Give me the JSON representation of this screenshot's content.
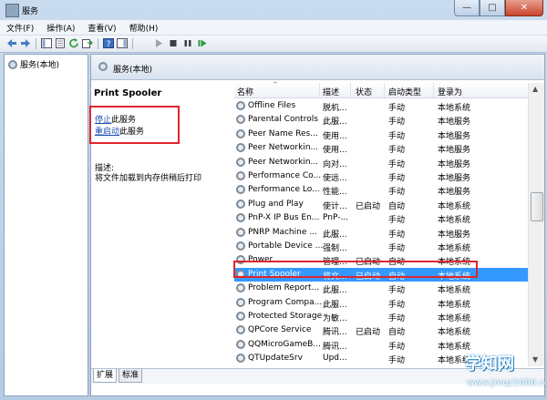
{
  "window": {
    "title": "服务",
    "controls": {
      "minimize": "—",
      "maximize": "□",
      "close": "✕"
    }
  },
  "menubar": [
    "文件(F)",
    "操作(A)",
    "查看(V)",
    "帮助(H)"
  ],
  "toolbar": {
    "icons": [
      "back-icon",
      "forward-icon",
      "console-tree-icon",
      "properties-icon",
      "refresh-icon",
      "export-icon",
      "help-icon",
      "action-pane-icon",
      "play-icon",
      "stop-icon",
      "pause-icon",
      "restart-icon"
    ]
  },
  "tree": {
    "item": "服务(本地)"
  },
  "pane_header": "服务(本地)",
  "detail": {
    "service_name": "Print Spooler",
    "stop_link": "停止",
    "stop_suffix": "此服务",
    "restart_link": "重启动",
    "restart_suffix": "此服务",
    "desc_label": "描述:",
    "desc": "将文件加载到内存供稍后打印"
  },
  "columns": [
    "名称",
    "描述",
    "状态",
    "启动类型",
    "登录为"
  ],
  "rows": [
    {
      "name": "Offline Files",
      "desc": "脱机...",
      "status": "",
      "startup": "手动",
      "logon": "本地系统"
    },
    {
      "name": "Parental Controls",
      "desc": "此服...",
      "status": "",
      "startup": "手动",
      "logon": "本地服务"
    },
    {
      "name": "Peer Name Res...",
      "desc": "使用...",
      "status": "",
      "startup": "手动",
      "logon": "本地服务"
    },
    {
      "name": "Peer Networkin...",
      "desc": "使用...",
      "status": "",
      "startup": "手动",
      "logon": "本地服务"
    },
    {
      "name": "Peer Networkin...",
      "desc": "向对...",
      "status": "",
      "startup": "手动",
      "logon": "本地服务"
    },
    {
      "name": "Performance Co...",
      "desc": "使远...",
      "status": "",
      "startup": "手动",
      "logon": "本地服务"
    },
    {
      "name": "Performance Lo...",
      "desc": "性能...",
      "status": "",
      "startup": "手动",
      "logon": "本地服务"
    },
    {
      "name": "Plug and Play",
      "desc": "使计...",
      "status": "已启动",
      "startup": "自动",
      "logon": "本地系统"
    },
    {
      "name": "PnP-X IP Bus En...",
      "desc": "PnP-...",
      "status": "",
      "startup": "手动",
      "logon": "本地系统"
    },
    {
      "name": "PNRP Machine ...",
      "desc": "此服...",
      "status": "",
      "startup": "手动",
      "logon": "本地服务"
    },
    {
      "name": "Portable Device ...",
      "desc": "强制...",
      "status": "",
      "startup": "手动",
      "logon": "本地系统"
    },
    {
      "name": "Power",
      "desc": "管理...",
      "status": "已启动",
      "startup": "自动",
      "logon": "本地系统"
    },
    {
      "name": "Print Spooler",
      "desc": "将文...",
      "status": "已启动",
      "startup": "自动",
      "logon": "本地系统"
    },
    {
      "name": "Problem Report...",
      "desc": "此服...",
      "status": "",
      "startup": "手动",
      "logon": "本地系统"
    },
    {
      "name": "Program Compa...",
      "desc": "此服...",
      "status": "",
      "startup": "手动",
      "logon": "本地系统"
    },
    {
      "name": "Protected Storage",
      "desc": "为敏...",
      "status": "",
      "startup": "手动",
      "logon": "本地系统"
    },
    {
      "name": "QPCore Service",
      "desc": "腾讯...",
      "status": "已启动",
      "startup": "自动",
      "logon": "本地系统"
    },
    {
      "name": "QQMicroGameB...",
      "desc": "腾讯...",
      "status": "",
      "startup": "手动",
      "logon": "本地系统"
    },
    {
      "name": "QTUpdateSrv",
      "desc": "Upd...",
      "status": "",
      "startup": "手动",
      "logon": "本地系统"
    }
  ],
  "selected_row": "Print Spooler",
  "tabs": [
    "扩展",
    "标准"
  ],
  "watermark": {
    "brand": "学知网",
    "url": "www.jmqz1000.com"
  },
  "colors": {
    "selection": "#3399ff",
    "highlight_box": "#e1252b",
    "link": "#1a4fb5"
  }
}
